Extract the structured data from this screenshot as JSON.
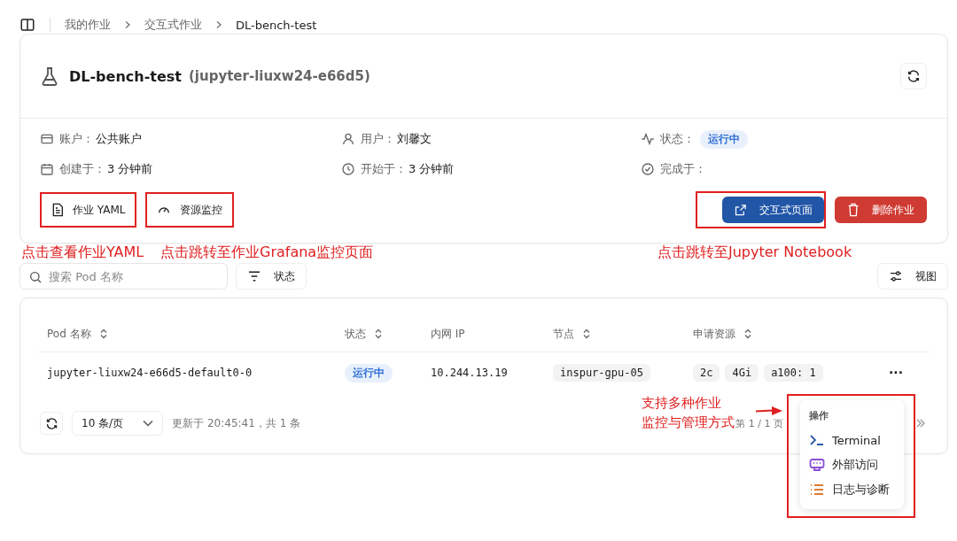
{
  "breadcrumb": [
    "我的作业",
    "交互式作业",
    "DL-bench-test"
  ],
  "job": {
    "name": "DL-bench-test",
    "id": "(jupyter-liuxw24-e66d5)"
  },
  "info": [
    {
      "kind": "account",
      "label": "账户：",
      "value": "公共账户"
    },
    {
      "kind": "user",
      "label": "用户：",
      "value": "刘馨文"
    },
    {
      "kind": "status",
      "label": "状态：",
      "value": "运行中"
    },
    {
      "kind": "created",
      "label": "创建于：",
      "value": "3 分钟前"
    },
    {
      "kind": "started",
      "label": "开始于：",
      "value": "3 分钟前"
    },
    {
      "kind": "finished",
      "label": "完成于："
    }
  ],
  "actions": [
    {
      "kind": "yaml",
      "label": "作业 YAML"
    },
    {
      "kind": "monitor",
      "label": "资源监控"
    },
    {
      "kind": "open",
      "label": "交互式页面"
    },
    {
      "kind": "delete",
      "label": "删除作业"
    }
  ],
  "search": {
    "placeholder": "搜索 Pod 名称"
  },
  "filter_button": "状态",
  "view_button": "视图",
  "table": {
    "columns": [
      {
        "label": "Pod 名称",
        "sortable": true
      },
      {
        "label": "状态",
        "sortable": true
      },
      {
        "label": "内网 IP",
        "sortable": false
      },
      {
        "label": "节点",
        "sortable": true
      },
      {
        "label": "申请资源",
        "sortable": true
      }
    ],
    "rows": [
      {
        "name": "jupyter-liuxw24-e66d5-default0-0",
        "status": "运行中",
        "ip": "10.244.13.19",
        "node": "inspur-gpu-05",
        "resources": [
          "2c",
          "4Gi",
          "a100: 1"
        ],
        "more": "···"
      }
    ]
  },
  "footer": {
    "page_size": "10 条/页",
    "updated": "更新于 20:45:41，共 1 条",
    "page": "第 1 / 1 页"
  },
  "menu": {
    "title": "操作",
    "items": [
      {
        "kind": "terminal",
        "label": "Terminal"
      },
      {
        "kind": "external",
        "label": "外部访问"
      },
      {
        "kind": "logs",
        "label": "日志与诊断"
      }
    ]
  },
  "annotations": [
    "点击查看作业YAML",
    "点击跳转至作业Grafana监控页面",
    "点击跳转至Jupyter Notebook"
  ],
  "menu_note": {
    "lines": [
      "支持多种作业",
      "监控与管理方式"
    ]
  }
}
